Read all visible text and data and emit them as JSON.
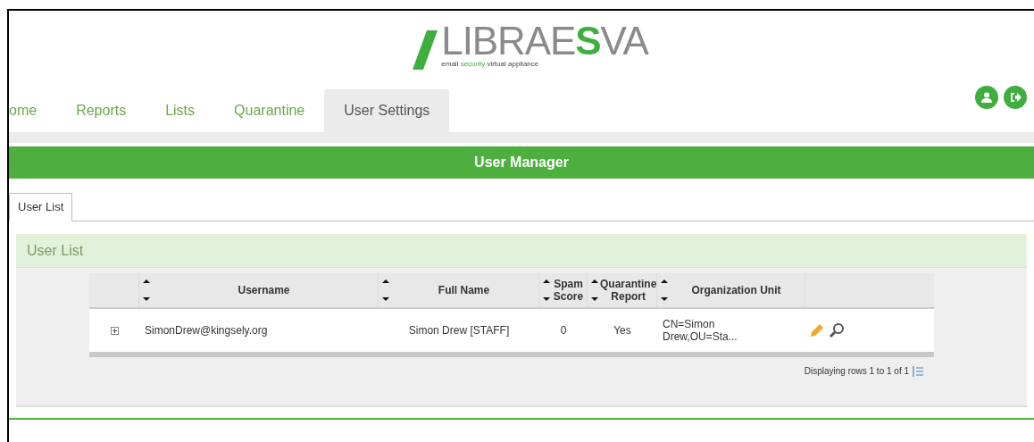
{
  "logo": {
    "name": "LIBRAE**S**VA",
    "tagline": "email **security** virtual appliance"
  },
  "nav_tabs": [
    {
      "label": "ome",
      "selected": false
    },
    {
      "label": "Reports",
      "selected": false
    },
    {
      "label": "Lists",
      "selected": false
    },
    {
      "label": "Quarantine",
      "selected": false
    },
    {
      "label": "User Settings",
      "selected": true
    }
  ],
  "header": {
    "title": "User Manager"
  },
  "sub_tabs": [
    {
      "label": "User List",
      "selected": true
    }
  ],
  "panel": {
    "title": "User List"
  },
  "table": {
    "columns": [
      {
        "label": "Username",
        "sortable": true
      },
      {
        "label": "Full Name",
        "sortable": true
      },
      {
        "label": "Spam Score",
        "sortable": true
      },
      {
        "label": "Quarantine Report",
        "sortable": true
      },
      {
        "label": "Organization Unit",
        "sortable": true
      }
    ],
    "rows": [
      {
        "expanded": false,
        "cells": [
          "SimonDrew@kingsely.org",
          "Simon Drew [STAFF]",
          "0",
          "Yes",
          "CN=Simon Drew,OU=Sta..."
        ]
      }
    ]
  },
  "footer": {
    "status": "Displaying rows 1 to 1 of 1"
  }
}
